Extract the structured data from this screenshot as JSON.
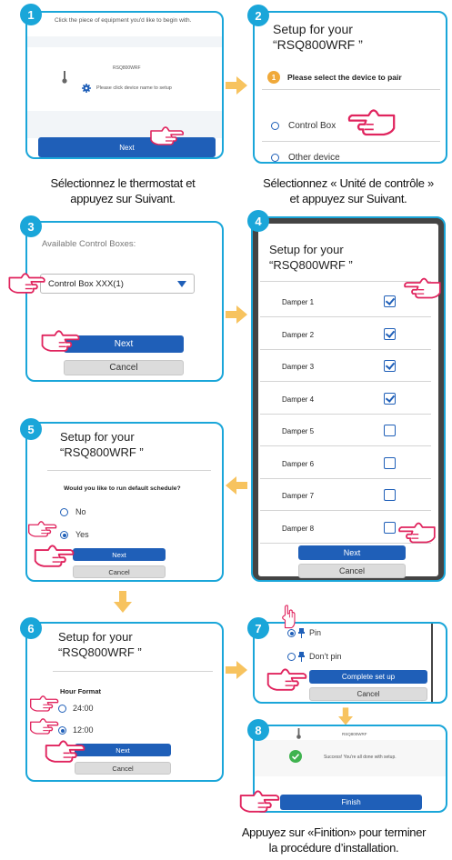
{
  "step1": {
    "num": "1",
    "instruction": "Click the piece of equipment you'd like to begin with.",
    "device_name": "RSQ800WRF",
    "hint": "Please click device name to setup",
    "next": "Next"
  },
  "step2": {
    "num": "2",
    "title": "Setup for your\n“RSQ800WRF ”",
    "step_num": "1",
    "step_text": "Please select the device to pair",
    "opt1": "Control Box",
    "opt2": "Other device"
  },
  "caption1": "Sélectionnez le thermostat et\nappuyez sur Suivant.",
  "caption2": "Sélectionnez « Unité de contrôle »\net appuyez sur Suivant.",
  "step3": {
    "num": "3",
    "label": "Available Control Boxes:",
    "select": "Control Box XXX(1)",
    "next": "Next",
    "cancel": "Cancel"
  },
  "step4": {
    "num": "4",
    "title": "Setup for your\n“RSQ800WRF ”",
    "dampers": [
      {
        "label": "Damper 1",
        "checked": true
      },
      {
        "label": "Damper 2",
        "checked": true
      },
      {
        "label": "Damper 3",
        "checked": true
      },
      {
        "label": "Damper 4",
        "checked": true
      },
      {
        "label": "Damper 5",
        "checked": false
      },
      {
        "label": "Damper 6",
        "checked": false
      },
      {
        "label": "Damper 7",
        "checked": false
      },
      {
        "label": "Damper 8",
        "checked": false
      }
    ],
    "next": "Next",
    "cancel": "Cancel"
  },
  "step5": {
    "num": "5",
    "title": "Setup for your\n“RSQ800WRF ”",
    "question": "Would you like to run default schedule?",
    "no": "No",
    "yes": "Yes",
    "next": "Next",
    "cancel": "Cancel"
  },
  "step6": {
    "num": "6",
    "title": "Setup for your\n“RSQ800WRF ”",
    "label": "Hour Format",
    "opt24": "24:00",
    "opt12": "12:00",
    "next": "Next",
    "cancel": "Cancel"
  },
  "step7": {
    "num": "7",
    "pin": "Pin",
    "dontpin": "Don’t pin",
    "complete": "Complete set up",
    "cancel": "Cancel"
  },
  "step8": {
    "num": "8",
    "device_name": "RSQ800WRF",
    "success": "Success! You're all done with setup.",
    "finish": "Finish"
  },
  "caption3": "Appuyez sur «Finition» pour terminer\nla procédure d’installation.",
  "colors": {
    "accent": "#1aa6d9",
    "button": "#1f5fb8",
    "arrow": "#f7c35f",
    "hand": "#e0245e",
    "success": "#3fb34f",
    "step_badge": "#f0a93a"
  }
}
